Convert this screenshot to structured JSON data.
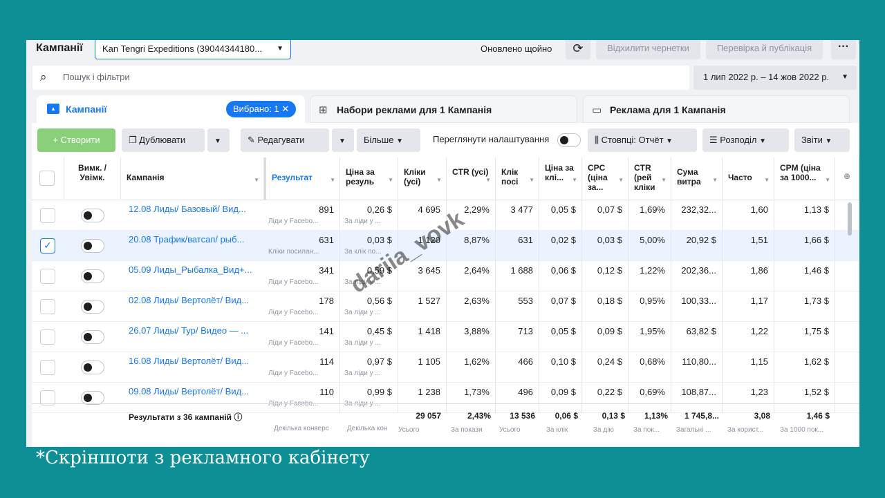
{
  "topbar": {
    "title": "Кампанії",
    "account": "Kan Tengri Expeditions (39044344180...",
    "updated": "Оновлено щойно",
    "discard": "Відхилити чернетки",
    "review": "Перевірка й публікація",
    "more": "···"
  },
  "search": {
    "placeholder": "Пошук і фільтри",
    "date_range": "1 лип 2022 р. – 14 жов 2022 р."
  },
  "tabs": {
    "campaigns": "Кампанії",
    "selected_chip": "Вибрано: 1",
    "adsets": "Набори реклами для 1 Кампанія",
    "ads": "Реклама для 1 Кампанія"
  },
  "toolbar": {
    "create": "+ Створити",
    "duplicate": "Дублювати",
    "edit": "Редагувати",
    "more": "Більше",
    "view_settings": "Переглянути налаштування",
    "columns": "Стовпці: Отчёт",
    "breakdown": "Розподіл",
    "reports": "Звіти"
  },
  "headers": {
    "toggle": "Вимк. / Увімк.",
    "campaign": "Кампанія",
    "results": "Результат",
    "cost_result": "Ціна за резуль",
    "clicks_all": "Кліки (усі)",
    "ctr_all": "CTR (усі)",
    "link_clicks": "Клік посі",
    "cost_click": "Ціна за клі...",
    "cpc": "CPC (ціна за...",
    "ctr_link": "CTR (рей кліки",
    "spend": "Сума витра",
    "frequency": "Часто",
    "cpm": "CPM (ціна за 1000..."
  },
  "rows": [
    {
      "name": "12.08 Лиды/ Базовый/ Вид...",
      "results": "891",
      "rsub": "Ліди у Facebo...",
      "cost": "0,26 $",
      "csub": "За ліди у ...",
      "clicks": "4 695",
      "ctr": "2,29%",
      "link": "3 477",
      "cpl": "0,05 $",
      "cpc": "0,07 $",
      "ctrl": "1,69%",
      "spend": "232,32...",
      "freq": "1,60",
      "cpm": "1,13 $"
    },
    {
      "name": "20.08 Трафик/ватсап/ рыб...",
      "results": "631",
      "rsub": "Кліки посилан...",
      "cost": "0,03 $",
      "csub": "За клік по...",
      "clicks": "1 120",
      "ctr": "8,87%",
      "link": "631",
      "cpl": "0,02 $",
      "cpc": "0,03 $",
      "ctrl": "5,00%",
      "spend": "20,92 $",
      "freq": "1,51",
      "cpm": "1,66 $"
    },
    {
      "name": "05.09 Лиды_Рыбалка_Вид+...",
      "results": "341",
      "rsub": "Ліди у Facebo...",
      "cost": "0,59 $",
      "csub": "За ліди у ...",
      "clicks": "3 645",
      "ctr": "2,64%",
      "link": "1 688",
      "cpl": "0,06 $",
      "cpc": "0,12 $",
      "ctrl": "1,22%",
      "spend": "202,36...",
      "freq": "1,86",
      "cpm": "1,46 $"
    },
    {
      "name": "02.08 Лиды/ Вертолёт/ Вид...",
      "results": "178",
      "rsub": "Ліди у Facebo...",
      "cost": "0,56 $",
      "csub": "За ліди у ...",
      "clicks": "1 527",
      "ctr": "2,63%",
      "link": "553",
      "cpl": "0,07 $",
      "cpc": "0,18 $",
      "ctrl": "0,95%",
      "spend": "100,33...",
      "freq": "1,17",
      "cpm": "1,73 $"
    },
    {
      "name": "26.07 Лиды/ Тур/ Видео — ...",
      "results": "141",
      "rsub": "Ліди у Facebo...",
      "cost": "0,45 $",
      "csub": "За ліди у ...",
      "clicks": "1 418",
      "ctr": "3,88%",
      "link": "713",
      "cpl": "0,05 $",
      "cpc": "0,09 $",
      "ctrl": "1,95%",
      "spend": "63,82 $",
      "freq": "1,22",
      "cpm": "1,75 $"
    },
    {
      "name": "16.08 Лиды/ Вертолёт/ Вид...",
      "results": "114",
      "rsub": "Ліди у Facebo...",
      "cost": "0,97 $",
      "csub": "За ліди у ...",
      "clicks": "1 105",
      "ctr": "1,62%",
      "link": "466",
      "cpl": "0,10 $",
      "cpc": "0,24 $",
      "ctrl": "0,68%",
      "spend": "110,80...",
      "freq": "1,15",
      "cpm": "1,62 $"
    },
    {
      "name": "09.08 Лиды/ Вертолёт/ Вид...",
      "results": "110",
      "rsub": "Ліди у Facebo...",
      "cost": "0,99 $",
      "csub": "За ліди у ...",
      "clicks": "1 238",
      "ctr": "1,73%",
      "link": "496",
      "cpl": "0,09 $",
      "cpc": "0,22 $",
      "ctrl": "0,69%",
      "spend": "108,87...",
      "freq": "1,23",
      "cpm": "1,52 $"
    }
  ],
  "totals": {
    "label": "Результати з 36 кампаній",
    "results_sub": "Декілька конверс",
    "cost_sub": "Декілька кон",
    "clicks": "29 057",
    "clicks_sub": "Усього",
    "ctr": "2,43%",
    "ctr_sub": "За покази",
    "link": "13 536",
    "link_sub": "Усього",
    "cpl": "0,06 $",
    "cpl_sub": "За клік",
    "cpc": "0,13 $",
    "cpc_sub": "За дію",
    "ctrl": "1,13%",
    "ctrl_sub": "За пок...",
    "spend": "1 745,8...",
    "spend_sub": "Загальні ...",
    "freq": "3,08",
    "freq_sub": "За корист...",
    "cpm": "1,46 $",
    "cpm_sub": "За 1000 пок..."
  },
  "watermark": "dariia_vovk",
  "caption": "*Скріншоти з рекламного кабінету"
}
